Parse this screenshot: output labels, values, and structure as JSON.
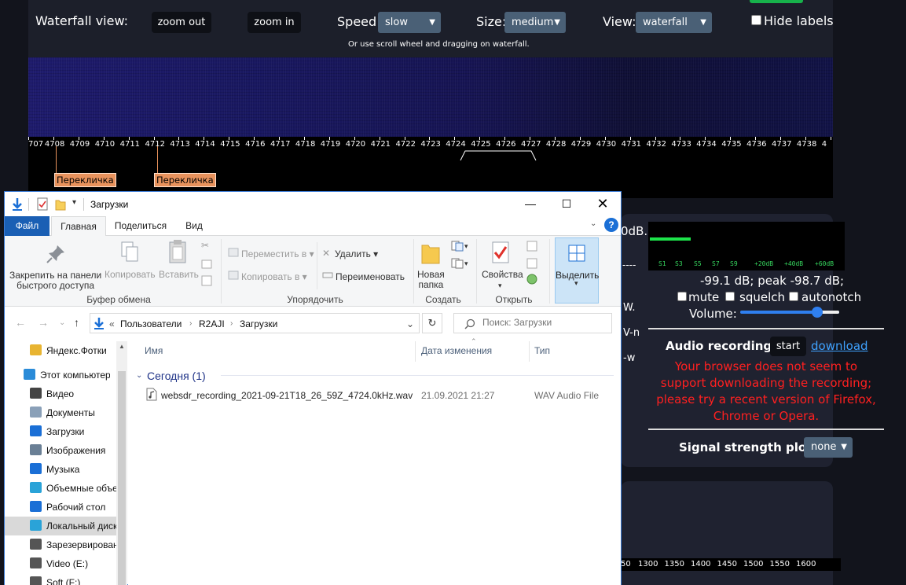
{
  "sdr": {
    "waterfall_label": "Waterfall view:",
    "zoom_out": "zoom out",
    "zoom_in": "zoom in",
    "speed_label": "Speed:",
    "speed_value": "slow",
    "size_label": "Size:",
    "size_value": "medium",
    "view_label": "View:",
    "view_value": "waterfall",
    "hide_labels": "Hide labels",
    "hint": "Or use scroll wheel and dragging on waterfall.",
    "freq_ticks": [
      "707",
      "4708",
      "4709",
      "4710",
      "4711",
      "4712",
      "4713",
      "4714",
      "4715",
      "4716",
      "4717",
      "4718",
      "4719",
      "4720",
      "4721",
      "4722",
      "4723",
      "4724",
      "4725",
      "4726",
      "4727",
      "4728",
      "4729",
      "4730",
      "4731",
      "4732",
      "4733",
      "4734",
      "4735",
      "4736",
      "4737",
      "4738",
      "4"
    ],
    "markers": [
      "Перекличка",
      "Перекличка"
    ],
    "panel": {
      "db_fragment": "0dB.",
      "meter_labels": [
        "S1",
        "S3",
        "S5",
        "S7",
        "S9",
        "+20dB",
        "+40dB",
        "+60dB"
      ],
      "level_text": "-99.1 dB; peak   -98.7 dB;",
      "mute": "mute",
      "squelch": "squelch",
      "autonotch": "autonotch",
      "volume": "Volume:",
      "volume_level": 0.78,
      "left_fragments": [
        "----",
        "W.",
        "V-n",
        "-w"
      ],
      "audio_recording": "Audio recording:",
      "start": "start",
      "download": "download",
      "warning": "Your browser does not seem to support downloading the recording; please try a recent version of Firefox, Chrome or Opera.",
      "signal_plot": "Signal strength plot:",
      "signal_plot_value": "none",
      "bottom_scale": [
        "50",
        "1300",
        "1350",
        "1400",
        "1450",
        "1500",
        "1550",
        "1600"
      ]
    }
  },
  "explorer": {
    "title": "Загрузки",
    "tabs": {
      "file": "Файл",
      "home": "Главная",
      "share": "Поделиться",
      "view": "Вид"
    },
    "ribbon": {
      "pin": "Закрепить на панели\nбыстрого доступа",
      "copy": "Копировать",
      "paste": "Вставить",
      "clipboard_group": "Буфер обмена",
      "move_to": "Переместить в",
      "copy_to": "Копировать в",
      "delete": "Удалить",
      "rename": "Переименовать",
      "organize_group": "Упорядочить",
      "new_folder": "Новая\nпапка",
      "create_group": "Создать",
      "properties": "Свойства",
      "open_group": "Открыть",
      "select": "Выделить"
    },
    "address": {
      "crumbs": [
        "Пользователи",
        "R2AJI",
        "Загрузки"
      ],
      "search_placeholder": "Поиск: Загрузки"
    },
    "nav": [
      {
        "label": "Яндекс.Фотки",
        "icon": "yandex-photos-icon"
      },
      {
        "label": "Этот компьютер",
        "icon": "computer-icon"
      },
      {
        "label": "Видео",
        "icon": "video-folder-icon"
      },
      {
        "label": "Документы",
        "icon": "documents-folder-icon"
      },
      {
        "label": "Загрузки",
        "icon": "downloads-folder-icon"
      },
      {
        "label": "Изображения",
        "icon": "pictures-folder-icon"
      },
      {
        "label": "Музыка",
        "icon": "music-folder-icon"
      },
      {
        "label": "Объемные объекты",
        "icon": "3d-objects-folder-icon"
      },
      {
        "label": "Рабочий стол",
        "icon": "desktop-folder-icon"
      },
      {
        "label": "Локальный диск",
        "icon": "local-disk-icon"
      },
      {
        "label": "Зарезервировано",
        "icon": "drive-icon"
      },
      {
        "label": "Video (E:)",
        "icon": "drive-icon"
      },
      {
        "label": "Soft (F:)",
        "icon": "drive-icon"
      }
    ],
    "columns": {
      "name": "Имя",
      "date": "Дата изменения",
      "type": "Тип"
    },
    "group": "Сегодня (1)",
    "files": [
      {
        "name": "websdr_recording_2021-09-21T18_26_59Z_4724.0kHz.wav",
        "date": "21.09.2021 21:27",
        "type": "WAV Audio File"
      }
    ]
  }
}
